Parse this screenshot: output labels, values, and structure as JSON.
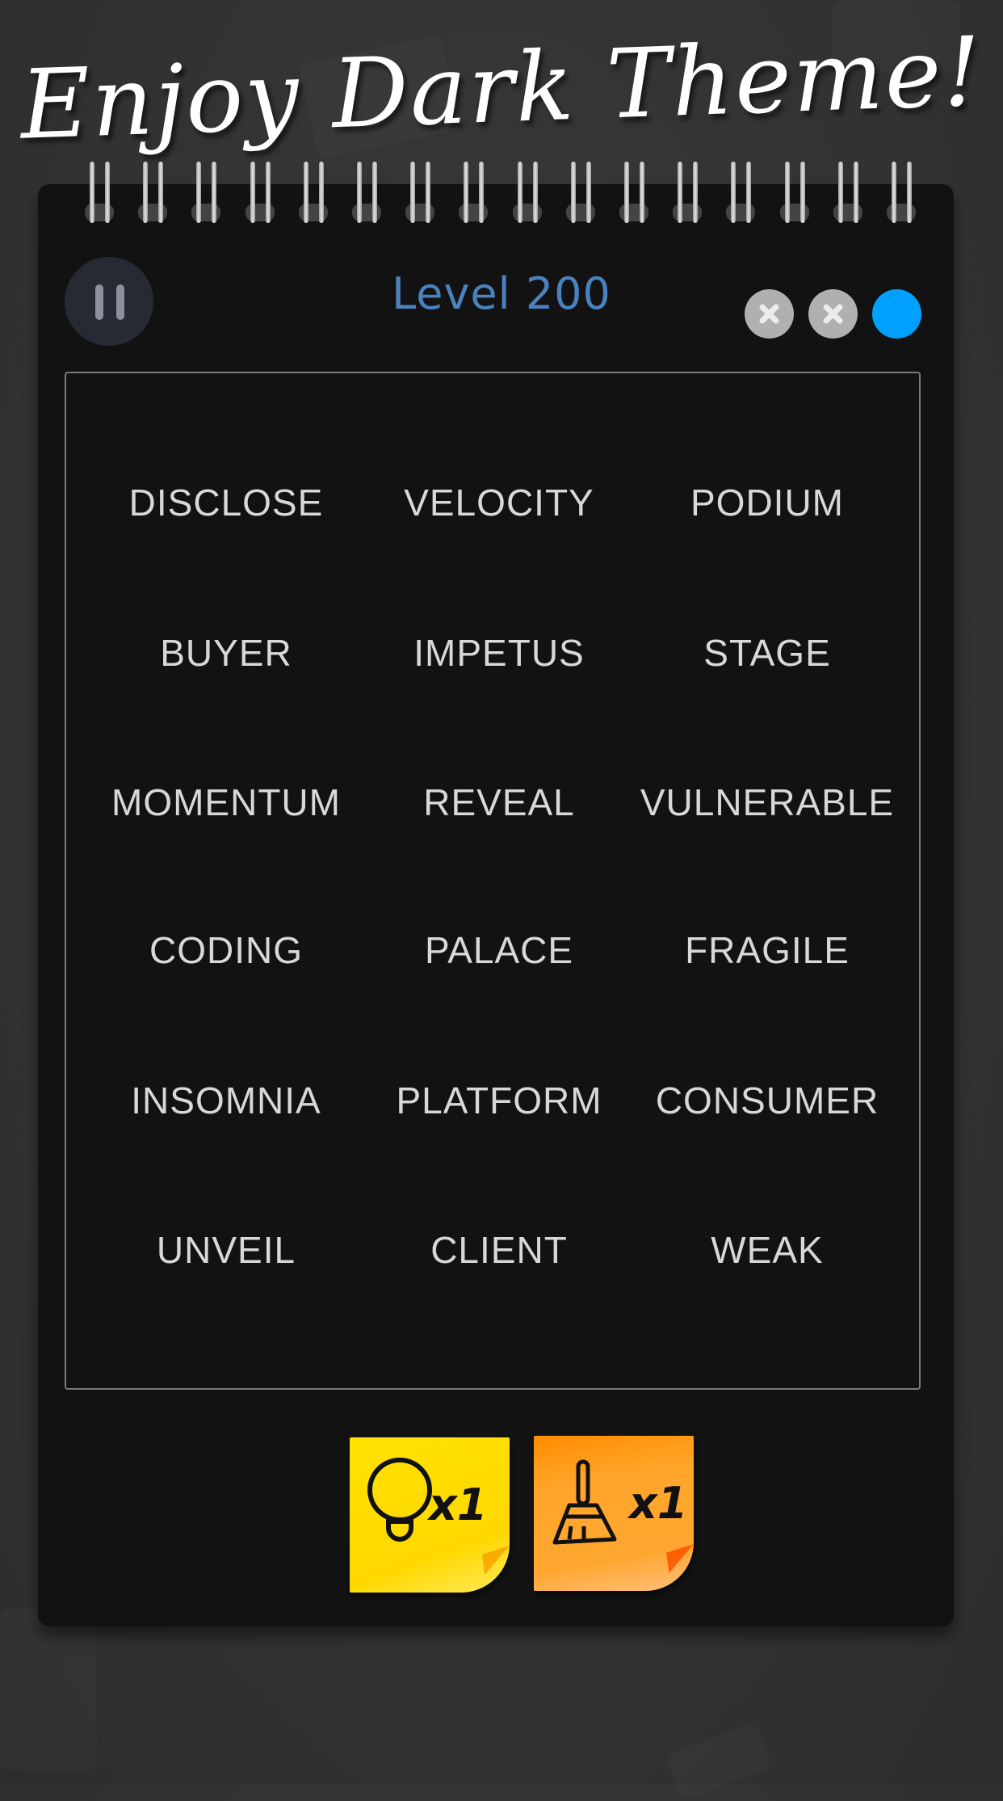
{
  "promo": {
    "title": "Enjoy Dark Theme!"
  },
  "header": {
    "level_label": "Level 200",
    "pause_icon": "pause-icon"
  },
  "lives": {
    "total": 3,
    "lost": 2,
    "items": [
      {
        "state": "lost",
        "icon": "x-icon",
        "color": "#b0b0b0"
      },
      {
        "state": "lost",
        "icon": "x-icon",
        "color": "#b0b0b0"
      },
      {
        "state": "remaining",
        "icon": "dot",
        "color": "#00a0ff"
      }
    ]
  },
  "board": {
    "columns": 3,
    "words": [
      [
        "DISCLOSE",
        "VELOCITY",
        "PODIUM"
      ],
      [
        "BUYER",
        "IMPETUS",
        "STAGE"
      ],
      [
        "MOMENTUM",
        "REVEAL",
        "VULNERABLE"
      ],
      [
        "CODING",
        "PALACE",
        "FRAGILE"
      ],
      [
        "INSOMNIA",
        "PLATFORM",
        "CONSUMER"
      ],
      [
        "UNVEIL",
        "CLIENT",
        "WEAK"
      ]
    ]
  },
  "powerups": [
    {
      "name": "hint",
      "icon": "lightbulb-icon",
      "count_label": "x1",
      "color": "#ffdd00"
    },
    {
      "name": "sweep",
      "icon": "broom-icon",
      "count_label": "x1",
      "color": "#ffa020"
    }
  ],
  "colors": {
    "background": "#343436",
    "notebook": "#121212",
    "level_text": "#4a82c0",
    "word_text": "#d8d8d8"
  }
}
